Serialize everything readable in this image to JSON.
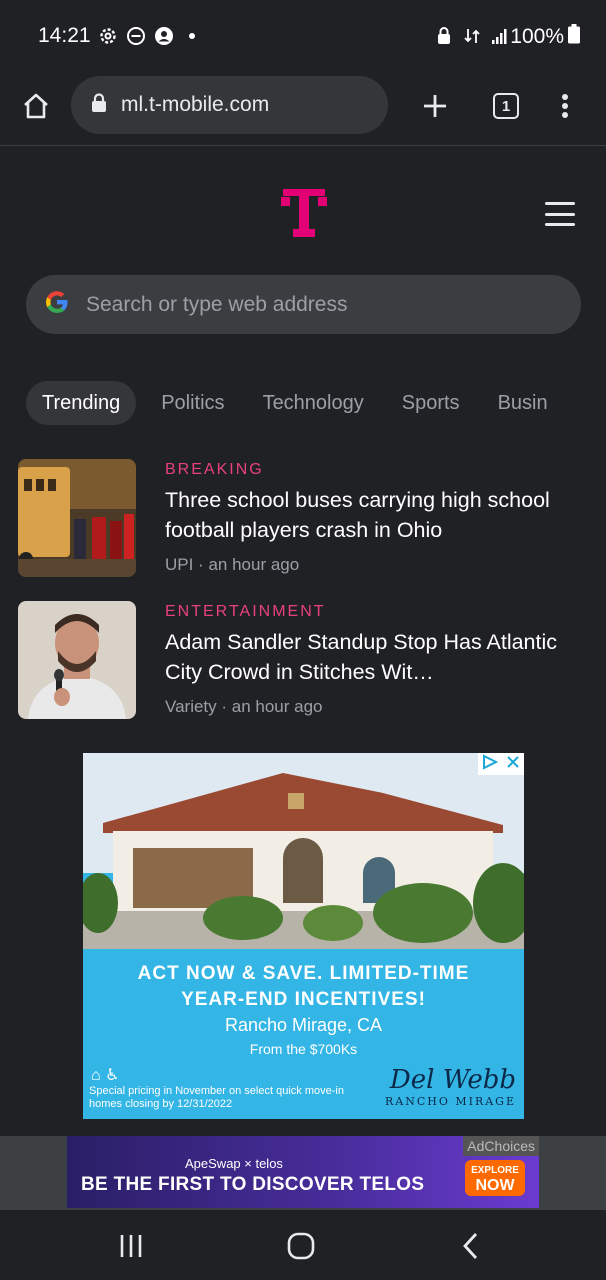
{
  "status_bar": {
    "time": "14:21",
    "battery": "100%",
    "icons_left": [
      "settings-icon",
      "dnd-icon",
      "account-icon",
      "dot"
    ],
    "icons_right": [
      "lock-icon",
      "data-icon",
      "signal-icon",
      "battery-icon"
    ]
  },
  "toolbar": {
    "url": "ml.t-mobile.com",
    "tab_count": "1"
  },
  "brand": {
    "logo_letter": "T",
    "accent_color": "#e20074"
  },
  "search": {
    "placeholder": "Search or type web address"
  },
  "tabs": [
    {
      "label": "Trending",
      "active": true
    },
    {
      "label": "Politics",
      "active": false
    },
    {
      "label": "Technology",
      "active": false
    },
    {
      "label": "Sports",
      "active": false
    },
    {
      "label": "Busin",
      "active": false
    }
  ],
  "articles": [
    {
      "category": "BREAKING",
      "headline": "Three school buses carrying high school football players crash in Ohio",
      "meta": "UPI · an hour ago"
    },
    {
      "category": "ENTERTAINMENT",
      "headline": "Adam Sandler Standup Stop Has Atlantic City Crowd in Stitches Wit…",
      "meta": "Variety · an hour ago"
    }
  ],
  "ad": {
    "headline_line1": "ACT NOW & SAVE. LIMITED-TIME",
    "headline_line2": "YEAR-END INCENTIVES!",
    "location": "Rancho Mirage, CA",
    "price": "From the $700Ks",
    "fine_print": "Special pricing in November on select quick move-in homes closing by 12/31/2022",
    "brand_name": "Del Webb",
    "brand_sub": "RANCHO MIRAGE"
  },
  "banner": {
    "adchoices": "AdChoices",
    "brands": "ApeSwap × telos",
    "cta": "BE THE FIRST TO DISCOVER TELOS",
    "explore_top": "EXPLORE",
    "explore_bottom": "NOW"
  }
}
